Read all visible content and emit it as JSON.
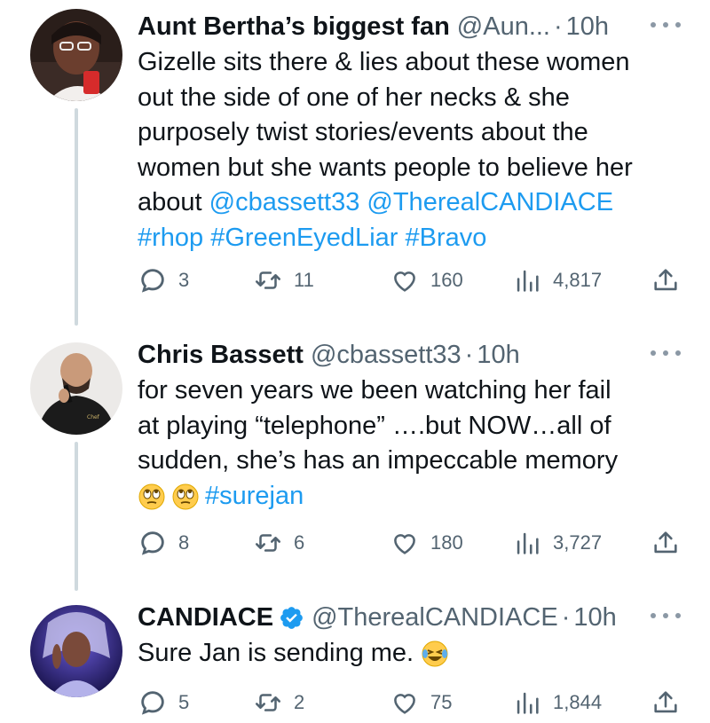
{
  "tweets": [
    {
      "display_name": "Aunt Bertha’s biggest fan",
      "handle": "@Aun...",
      "time": "10h",
      "verified": false,
      "text_lines": [
        {
          "parts": [
            {
              "t": "Gizelle sits there & lies about these women",
              "link": false
            }
          ]
        },
        {
          "parts": [
            {
              "t": "out the side of one of her necks & she",
              "link": false
            }
          ]
        },
        {
          "parts": [
            {
              "t": "purposely twist stories/events about the",
              "link": false
            }
          ]
        },
        {
          "parts": [
            {
              "t": "women but she wants people to believe her",
              "link": false
            }
          ]
        },
        {
          "parts": [
            {
              "t": "about ",
              "link": false
            },
            {
              "t": "@cbassett33",
              "link": true
            },
            {
              "t": " ",
              "link": false
            },
            {
              "t": "@TherealCANDIACE",
              "link": true
            }
          ]
        },
        {
          "parts": [
            {
              "t": "#rhop",
              "link": true
            },
            {
              "t": " ",
              "link": false
            },
            {
              "t": "#GreenEyedLiar",
              "link": true
            },
            {
              "t": " ",
              "link": false
            },
            {
              "t": "#Bravo",
              "link": true
            }
          ]
        }
      ],
      "replies": "3",
      "retweets": "11",
      "likes": "160",
      "views": "4,817"
    },
    {
      "display_name": "Chris Bassett",
      "handle": "@cbassett33",
      "time": "10h",
      "verified": false,
      "text_lines": [
        {
          "parts": [
            {
              "t": "for seven years we been watching her fail",
              "link": false
            }
          ]
        },
        {
          "parts": [
            {
              "t": "at playing “telephone” ….but NOW…all of",
              "link": false
            }
          ]
        },
        {
          "parts": [
            {
              "t": "sudden, she’s has an impeccable memory",
              "link": false
            }
          ]
        },
        {
          "parts": [
            {
              "emoji": "eye-roll-emoji"
            },
            {
              "emoji": "eye-roll-emoji"
            },
            {
              "t": "#surejan",
              "link": true
            }
          ]
        }
      ],
      "replies": "8",
      "retweets": "6",
      "likes": "180",
      "views": "3,727"
    },
    {
      "display_name": "CANDIACE",
      "handle": "@TherealCANDIACE",
      "time": "10h",
      "verified": true,
      "text_lines": [
        {
          "parts": [
            {
              "t": "Sure Jan is sending me. ",
              "link": false
            },
            {
              "emoji": "laughing-emoji"
            }
          ]
        }
      ],
      "replies": "5",
      "retweets": "2",
      "likes": "75",
      "views": "1,844"
    }
  ],
  "icons": {
    "reply": "reply-icon",
    "retweet": "retweet-icon",
    "like": "like-icon",
    "views": "views-icon",
    "share": "share-icon",
    "more": "more-icon",
    "verified": "verified-badge-icon"
  },
  "colors": {
    "link": "#1d9bf0",
    "secondary_text": "#536471",
    "thread_line": "#cfd9de",
    "verified": "#1d9bf0"
  }
}
